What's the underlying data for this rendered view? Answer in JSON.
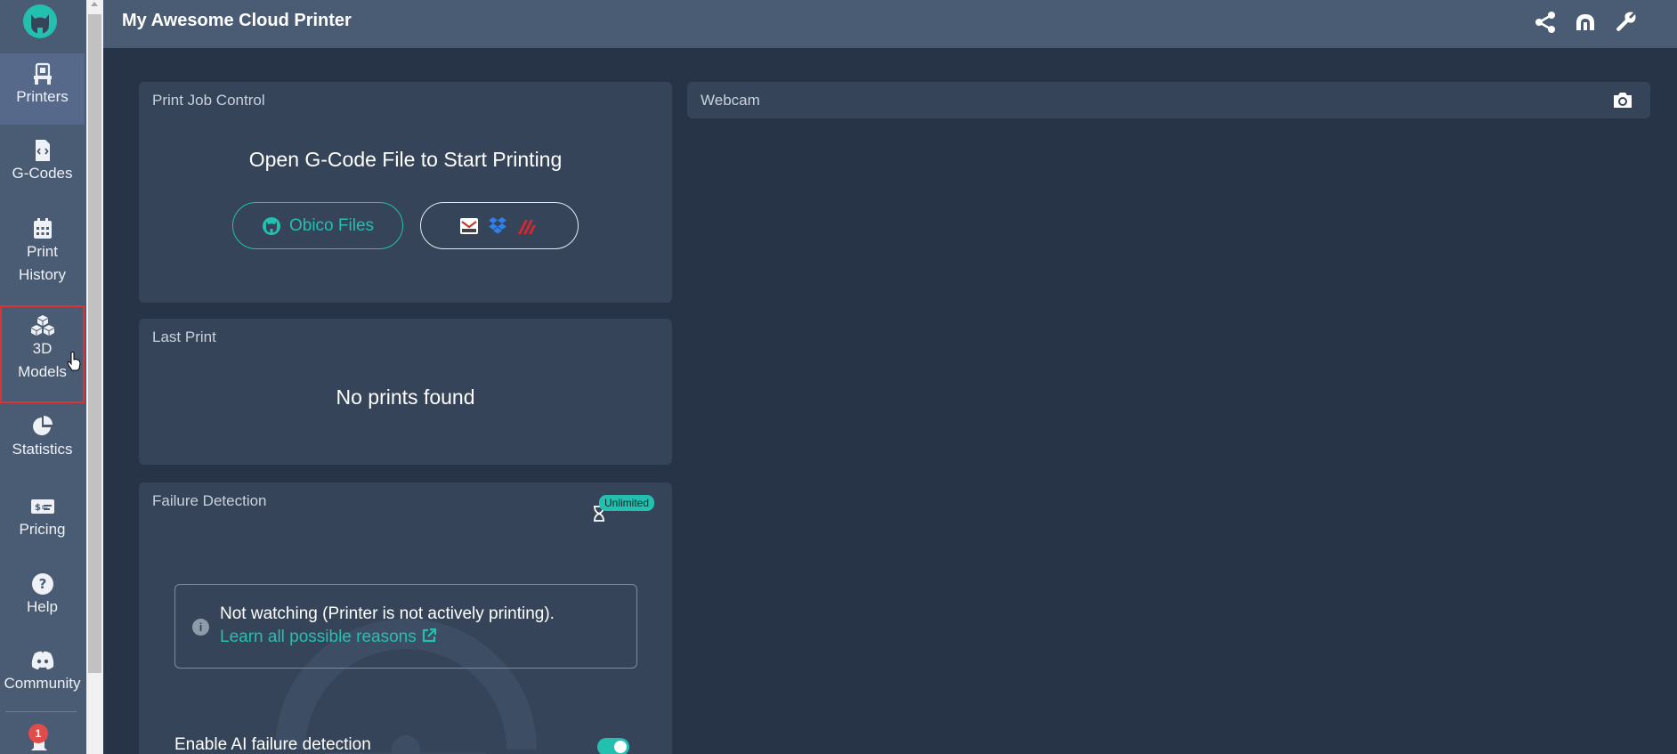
{
  "app": {
    "title": "My Awesome Cloud Printer"
  },
  "sidebar": {
    "items": [
      {
        "label": "Printers"
      },
      {
        "label": "G-Codes"
      },
      {
        "label_line1": "Print",
        "label_line2": "History"
      },
      {
        "label_line1": "3D",
        "label_line2": "Models"
      },
      {
        "label": "Statistics"
      },
      {
        "label": "Pricing"
      },
      {
        "label": "Help"
      },
      {
        "label": "Community"
      }
    ],
    "notification_count": "1"
  },
  "topbar": {
    "icons": [
      "share-icon",
      "octoprint-tunnel-icon",
      "wrench-icon"
    ]
  },
  "print_job_control": {
    "title": "Print Job Control",
    "heading": "Open G-Code File to Start Printing",
    "obico_files_label": "Obico Files",
    "external_sources": [
      "thingiverse-icon",
      "dropbox-icon",
      "printables-icon"
    ]
  },
  "last_print": {
    "title": "Last Print",
    "message": "No prints found"
  },
  "failure_detection": {
    "title": "Failure Detection",
    "plan_badge": "Unlimited",
    "status_text": "Not watching (Printer is not actively printing).",
    "link_text": "Learn all possible reasons",
    "toggle_label": "Enable AI failure detection",
    "toggle_on": true
  },
  "webcam": {
    "title": "Webcam"
  },
  "colors": {
    "accent": "#23c0b0",
    "background": "#273447",
    "card": "#354458",
    "topbar": "#4a5c74"
  }
}
